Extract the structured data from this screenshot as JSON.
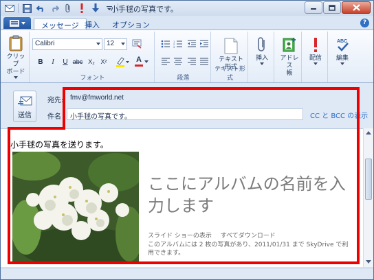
{
  "window": {
    "title": "小手毬の写真です。"
  },
  "ribbon_tabs": {
    "message": "メッセージ",
    "insert": "挿入",
    "options": "オプション"
  },
  "clipboard": {
    "label": "クリップボード",
    "paste_label": "クリップ\nボード"
  },
  "font": {
    "name": "Calibri",
    "size": "12",
    "group_label": "フォント",
    "bold": "B",
    "italic": "I",
    "underline": "U",
    "strike": "abc",
    "subscript": "X₂",
    "superscript": "X²",
    "color_letter": "A"
  },
  "paragraph": {
    "group_label": "段落"
  },
  "plain_text": {
    "button_label": "テキスト\n形式",
    "group_label": "テキスト形式"
  },
  "insert_group": {
    "label": "挿入"
  },
  "address_book": {
    "label": "アドレス\n帳"
  },
  "delivery": {
    "label": "配信"
  },
  "editing": {
    "label": "編集"
  },
  "compose": {
    "send_label": "送信",
    "to_label": "宛先:",
    "to_value": "fmv@fmworld.net",
    "subject_label": "件名",
    "subject_value": "小手毬の写真です。",
    "cc_bcc_link": "CC と BCC の表示"
  },
  "message_body": {
    "intro_text": "小手毬の写真を送ります。",
    "album_title": "ここにアルバムの名前を入力します",
    "slideshow_link": "スライド ショーの表示",
    "download_link": "すべてダウンロード",
    "album_info": "このアルバムには 2 枚の写真があり、2011/01/31 まで SkyDrive で利用できます。"
  },
  "colors": {
    "annotation": "#ee0000",
    "accent": "#2456a0",
    "link": "#2a6bc8"
  }
}
